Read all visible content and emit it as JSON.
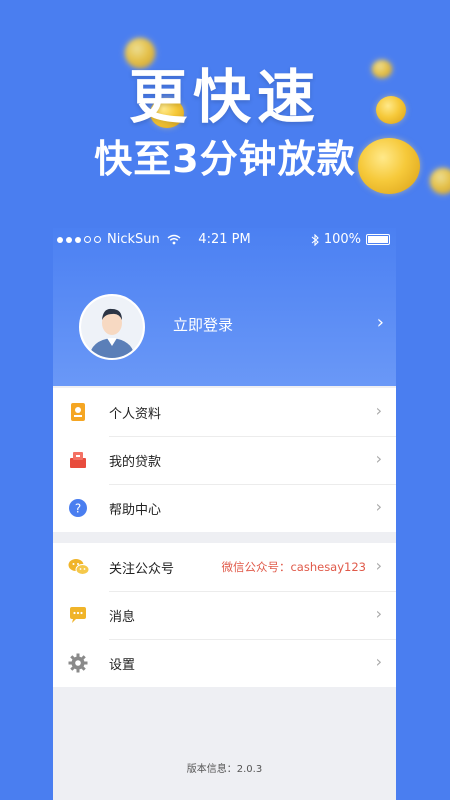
{
  "banner": {
    "title": "更快速",
    "subtitle": "快至3分钟放款"
  },
  "status_bar": {
    "carrier": "NickSun",
    "time": "4:21 PM",
    "battery": "100%"
  },
  "profile": {
    "login_label": "立即登录"
  },
  "menu_group_1": [
    {
      "label": "个人资料",
      "icon": "profile-card-icon",
      "color": "#f5a623"
    },
    {
      "label": "我的贷款",
      "icon": "loan-icon",
      "color": "#e84c3d"
    },
    {
      "label": "帮助中心",
      "icon": "help-icon",
      "color": "#4a7ef0"
    }
  ],
  "menu_group_2": [
    {
      "label": "关注公众号",
      "icon": "wechat-icon",
      "color": "#f0b429",
      "extra": "微信公众号：cashesay123"
    },
    {
      "label": "消息",
      "icon": "message-icon",
      "color": "#f0b429"
    },
    {
      "label": "设置",
      "icon": "settings-icon",
      "color": "#8a8a8a"
    }
  ],
  "footer": {
    "version": "版本信息：2.0.3"
  }
}
